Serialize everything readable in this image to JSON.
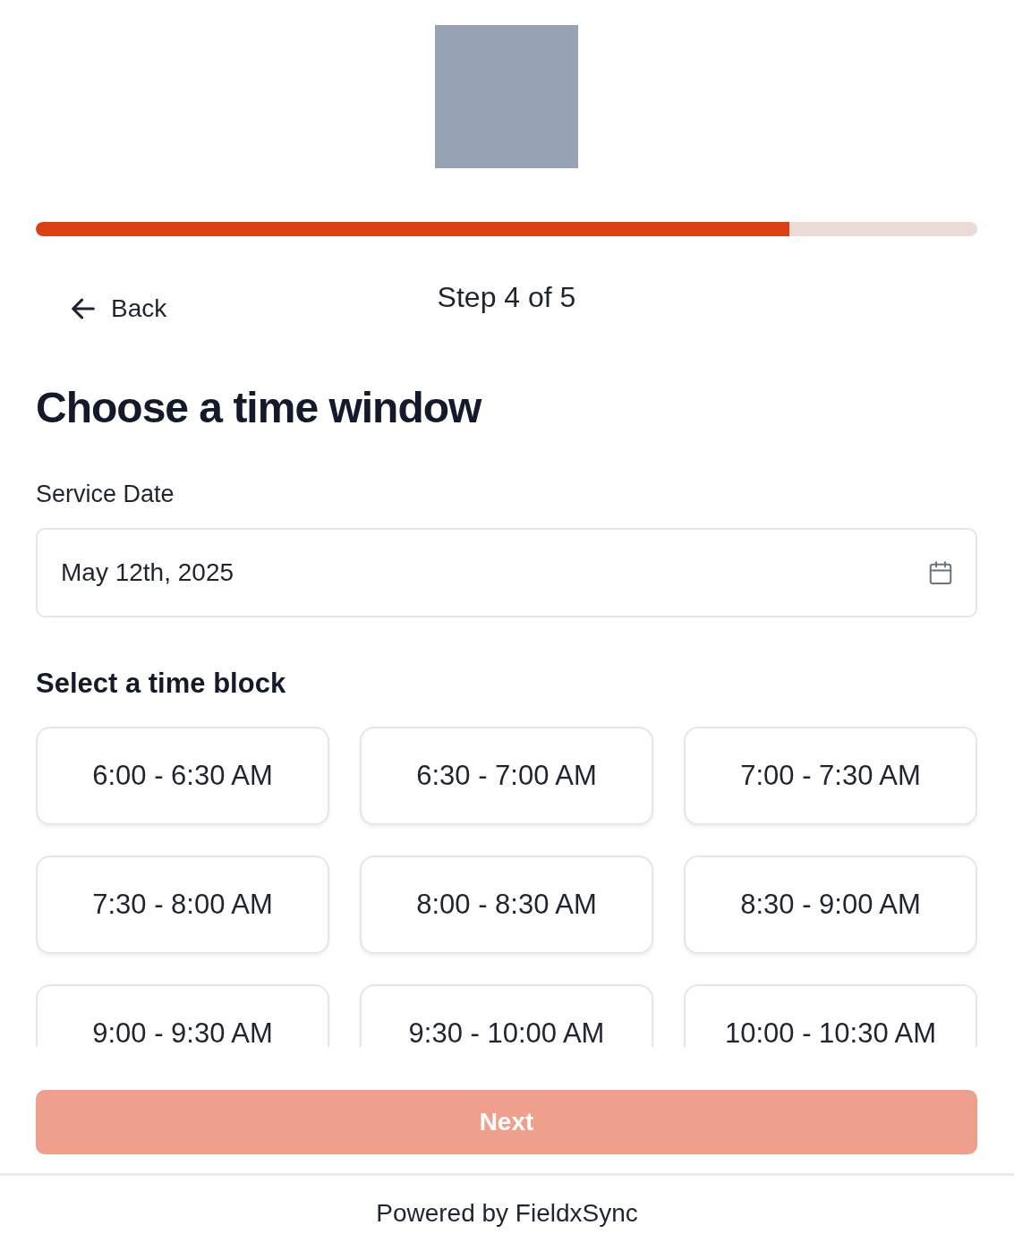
{
  "progress": {
    "level": 0.8
  },
  "nav": {
    "back": "Back",
    "step": "Step 4 of 5"
  },
  "title": "Choose a time window",
  "service_date": {
    "label": "Service Date",
    "value": "May 12th, 2025"
  },
  "time_block": {
    "heading": "Select a time block",
    "slots": [
      {
        "label": "6:00 - 6:30 AM",
        "selected": false
      },
      {
        "label": "6:30 - 7:00 AM",
        "selected": false
      },
      {
        "label": "7:00 - 7:30 AM",
        "selected": false
      },
      {
        "label": "7:30 - 8:00 AM",
        "selected": false
      },
      {
        "label": "8:00 - 8:30 AM",
        "selected": false
      },
      {
        "label": "8:30 - 9:00 AM",
        "selected": false
      },
      {
        "label": "9:00 - 9:30 AM",
        "selected": false
      },
      {
        "label": "9:30 - 10:00 AM",
        "selected": false
      },
      {
        "label": "10:00 - 10:30 AM",
        "selected": false
      }
    ]
  },
  "next_button": {
    "label": "Next",
    "disabled": true
  },
  "footer": "Powered by FieldxSync"
}
